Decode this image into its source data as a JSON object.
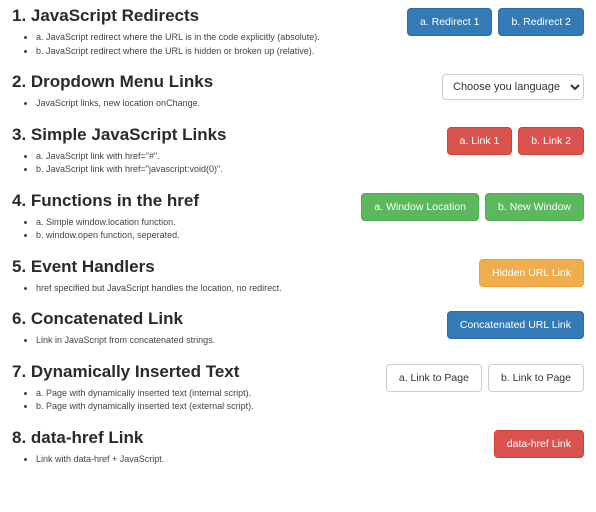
{
  "sections": [
    {
      "heading": "1. JavaScript Redirects",
      "bullets": [
        "a. JavaScript redirect where the URL is in the code explicitly (absolute).",
        "b. JavaScript redirect where the URL is hidden or broken up (relative)."
      ],
      "buttons": [
        {
          "label": "a. Redirect 1",
          "style": "primary"
        },
        {
          "label": "b. Redirect 2",
          "style": "primary"
        }
      ]
    },
    {
      "heading": "2. Dropdown Menu Links",
      "bullets": [
        "JavaScript links, new location onChange."
      ],
      "select": {
        "placeholder": "Choose you language"
      }
    },
    {
      "heading": "3. Simple JavaScript Links",
      "bullets": [
        "a. JavaScript link with href=\"#\".",
        "b. JavaScript link with href=\"javascript:void(0)\"."
      ],
      "buttons": [
        {
          "label": "a. Link 1",
          "style": "danger"
        },
        {
          "label": "b. Link 2",
          "style": "danger"
        }
      ]
    },
    {
      "heading": "4. Functions in the href",
      "bullets": [
        "a. Simple window.location function.",
        "b. window.open function, seperated."
      ],
      "buttons": [
        {
          "label": "a. Window Location",
          "style": "success"
        },
        {
          "label": "b. New Window",
          "style": "success"
        }
      ]
    },
    {
      "heading": "5. Event Handlers",
      "bullets": [
        "href specified but JavaScript handles the location, no redirect."
      ],
      "buttons": [
        {
          "label": "Hidden URL Link",
          "style": "warning"
        }
      ]
    },
    {
      "heading": "6. Concatenated Link",
      "bullets": [
        "Link in JavaScript from concatenated strings."
      ],
      "buttons": [
        {
          "label": "Concatenated URL Link",
          "style": "primary"
        }
      ]
    },
    {
      "heading": "7. Dynamically Inserted Text",
      "bullets": [
        "a. Page with dynamically inserted text (internal script).",
        "b. Page with dynamically inserted text (external script)."
      ],
      "buttons": [
        {
          "label": "a. Link to Page",
          "style": "default"
        },
        {
          "label": "b. Link to Page",
          "style": "default"
        }
      ]
    },
    {
      "heading": "8. data-href Link",
      "bullets": [
        "Link with data-href + JavaScript."
      ],
      "buttons": [
        {
          "label": "data-href Link",
          "style": "danger"
        }
      ]
    }
  ]
}
